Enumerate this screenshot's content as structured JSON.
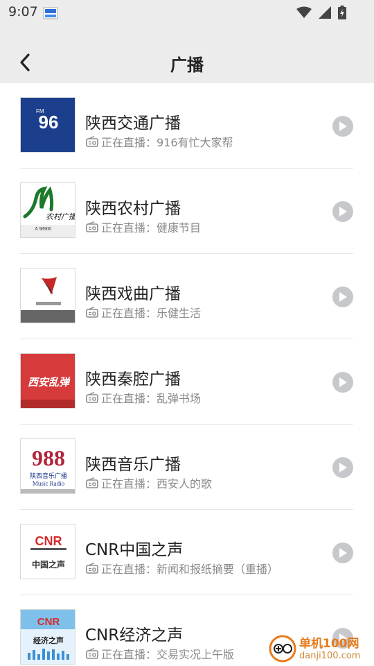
{
  "status_bar": {
    "time": "9:07",
    "icons": [
      "notification-app-icon",
      "wifi-icon",
      "signal-icon",
      "battery-charging-icon"
    ]
  },
  "header": {
    "back_icon": "chevron-left-icon",
    "title": "广播"
  },
  "stations": [
    {
      "name": "陕西交通广播",
      "now_playing": "正在直播：916有忙大家帮",
      "logo": "FM96",
      "logo_sub": "陕西交通广播"
    },
    {
      "name": "陕西农村广播",
      "now_playing": "正在直播：健康节目",
      "logo": "农村广播",
      "logo_sub": "A 98900"
    },
    {
      "name": "陕西戏曲广播",
      "now_playing": "正在直播：乐健生活",
      "logo": "",
      "logo_sub": ""
    },
    {
      "name": "陕西秦腔广播",
      "now_playing": "正在直播：乱弹书场",
      "logo": "西安乱弹",
      "logo_sub": ""
    },
    {
      "name": "陕西音乐广播",
      "now_playing": "正在直播：西安人的歌",
      "logo": "988",
      "logo_sub": "陕西音乐广播",
      "logo_sub2": "Music Radio"
    },
    {
      "name": "CNR中国之声",
      "now_playing": "正在直播：新闻和报纸摘要（重播）",
      "logo": "CNR",
      "logo_sub": "中国之声"
    },
    {
      "name": "CNR经济之声",
      "now_playing": "正在直播：交易实况上午版",
      "logo": "CNR",
      "logo_sub": "经济之声"
    }
  ],
  "watermark": {
    "title": "单机100网",
    "url": "danji100.com"
  },
  "colors": {
    "header_bg": "#ececec",
    "play_button": "#c7c8cc",
    "subtitle": "#8a8a8a"
  }
}
